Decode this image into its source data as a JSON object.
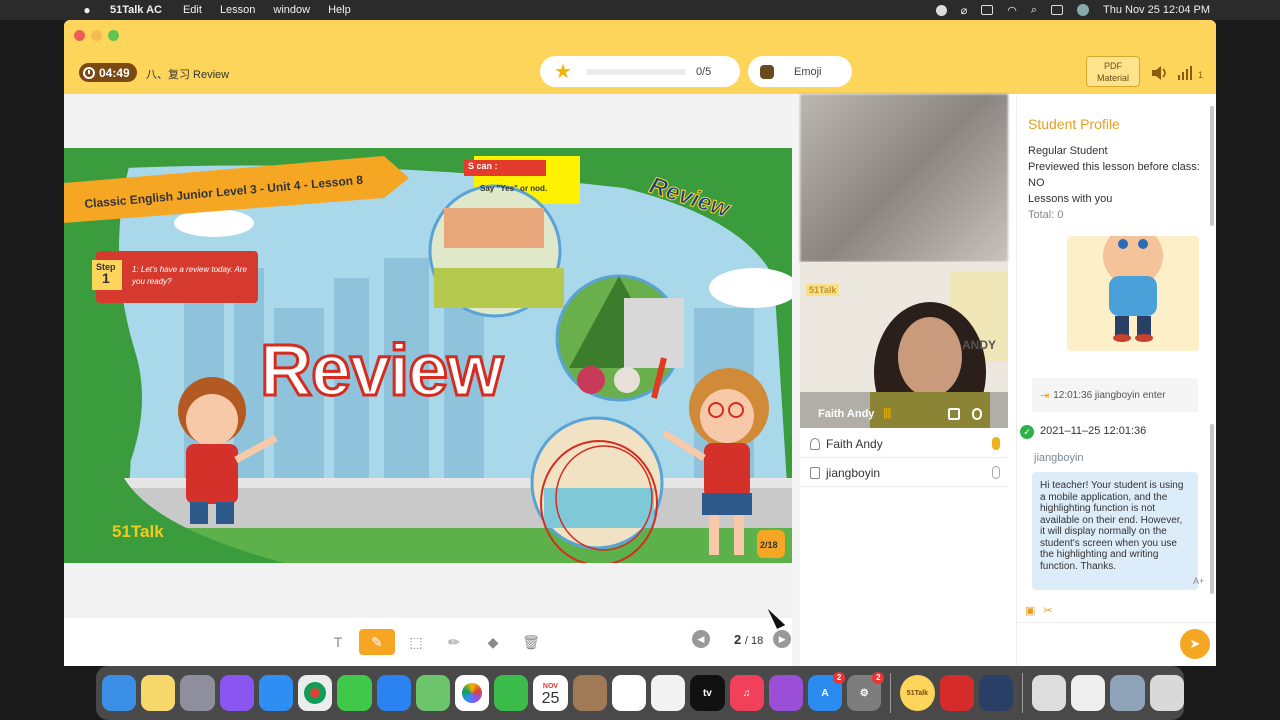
{
  "menubar": {
    "app": "51Talk AC",
    "items": [
      "Edit",
      "Lesson",
      "window",
      "Help"
    ],
    "datetime": "Thu Nov 25  12:04 PM"
  },
  "header": {
    "timer": "04:49",
    "lesson_title": "八、复习 Review",
    "stars_progress": "0/5",
    "emoji_label": "Emoji",
    "pdf_label": "PDF Material",
    "signal_value": "1"
  },
  "slide": {
    "course_banner": "Classic English Junior Level 3 - Unit 4 - Lesson 8",
    "step_label": "Step",
    "step_num": "1",
    "step_text": "1: Let's have a review today. Are you ready?",
    "s_can": "S can :",
    "s_can_text": "Say \"Yes\" or nod.",
    "review_corner": "Review",
    "review_big": "Review",
    "logo": "51Talk",
    "page_badge": "2/18"
  },
  "bottom_toolbar": {
    "page_current": "2",
    "page_total": "/ 18"
  },
  "video": {
    "student_label": "Faith Andy",
    "bg_tag": "51Talk",
    "bg_name": "ANDY",
    "participants": [
      "Faith Andy",
      "jiangboyin"
    ]
  },
  "profile": {
    "title": "Student Profile",
    "type": "Regular Student",
    "previewed_label": "Previewed this lesson before class: NO",
    "lessons_label": "Lessons with you",
    "total": "Total: 0"
  },
  "chat": {
    "enter_msg": "12:01:36 jiangboyin enter",
    "date": "2021–11–25 12:01:36",
    "sender": "jiangboyin",
    "message": "Hi teacher! Your student is using a mobile application, and the highlighting function is not available on their end. However, it will display normally on the student's screen when you use the highlighting and writing function. Thanks."
  },
  "dock": {
    "calendar_month": "NOV",
    "calendar_day": "25",
    "appstore_badge": "2",
    "settings_badge": "2",
    "talk_label": "51Talk"
  },
  "colors": {
    "accent": "#fdd55b",
    "orange": "#f5a623",
    "slide_green": "#3a9c3c"
  }
}
